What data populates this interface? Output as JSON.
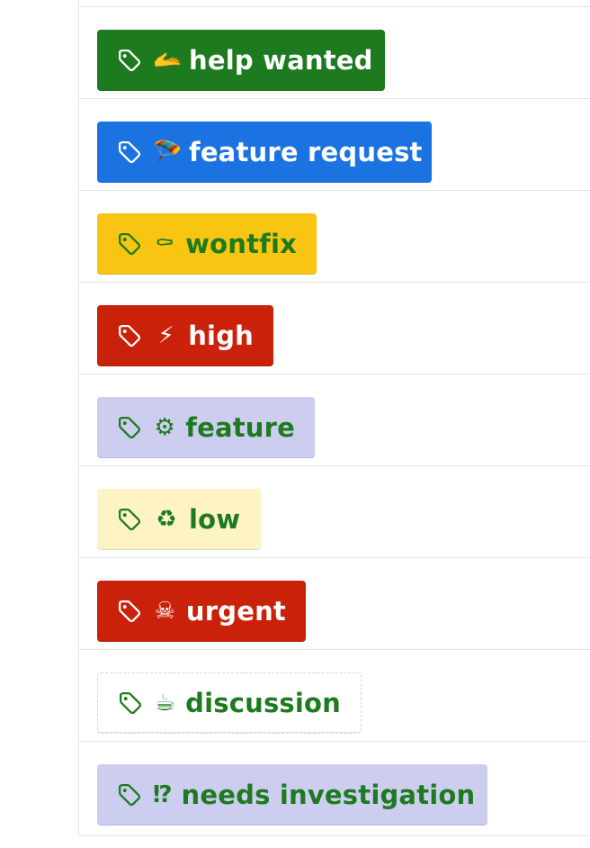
{
  "labels": [
    {
      "name": "help wanted",
      "emoji": "🫴",
      "bg": "#1d7a1f",
      "fg": "#ffffff",
      "border": "none",
      "width": 320
    },
    {
      "name": "feature request",
      "emoji": "🪂",
      "bg": "#1a73e0",
      "fg": "#ffffff",
      "border": "none",
      "width": 372
    },
    {
      "name": "wontfix",
      "emoji": "⚰",
      "bg": "#f9c513",
      "fg": "#1d7a1f",
      "border": "none",
      "width": 244
    },
    {
      "name": "high",
      "emoji": "⚡",
      "bg": "#c9210a",
      "fg": "#ffffff",
      "border": "none",
      "width": 196
    },
    {
      "name": "feature",
      "emoji": "⚙",
      "bg": "#cdcdf0",
      "fg": "#1d7a1f",
      "border": "none",
      "width": 242
    },
    {
      "name": "low",
      "emoji": "♻",
      "bg": "#fdf3c4",
      "fg": "#1d7a1f",
      "border": "none",
      "width": 182
    },
    {
      "name": "urgent",
      "emoji": "☠",
      "bg": "#c9210a",
      "fg": "#ffffff",
      "border": "none",
      "width": 232
    },
    {
      "name": "discussion",
      "emoji": "☕",
      "bg": "#ffffff",
      "fg": "#1d7a1f",
      "border": "1px dashed #d1d5da",
      "width": 294
    },
    {
      "name": "needs investigation",
      "emoji": "⁉",
      "bg": "#cdcdf0",
      "fg": "#1d7a1f",
      "border": "none",
      "width": 434
    }
  ],
  "icons": {
    "tag": "tag-icon"
  }
}
